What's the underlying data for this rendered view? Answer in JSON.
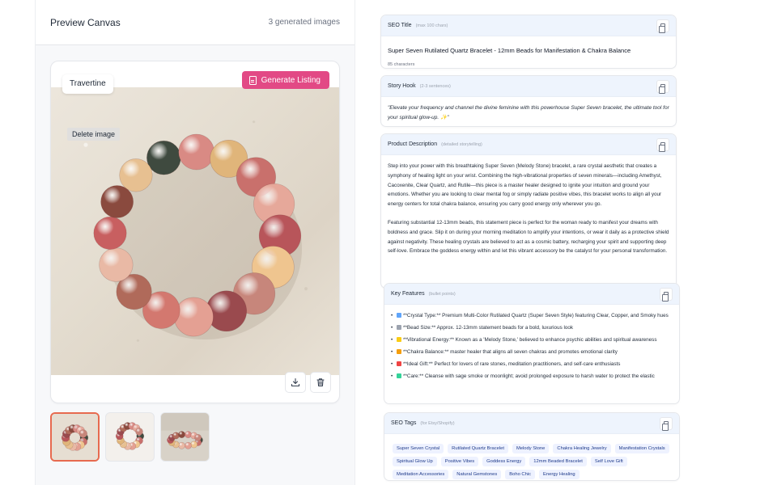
{
  "canvas": {
    "title": "Preview Canvas",
    "count": "3 generated images",
    "chip_label": "Travertine",
    "generate_label": "Generate Listing",
    "tooltip": "Delete image",
    "actions": [
      "download-icon",
      "trash-icon"
    ],
    "thumbnails": [
      {
        "name": "thumbnail-1",
        "selected": true
      },
      {
        "name": "thumbnail-2",
        "selected": false
      },
      {
        "name": "thumbnail-3",
        "selected": false
      }
    ],
    "accent": "#e24985"
  },
  "seo_title": {
    "label": "SEO Title",
    "hint": "(max 100 chars)",
    "value": "Super Seven Rutilated Quartz Bracelet - 12mm Beads for Manifestation & Chakra Balance",
    "count": "85 characters"
  },
  "story_hook": {
    "label": "Story Hook",
    "hint": "(2-3 sentences)",
    "value": "\"Elevate your frequency and channel the divine feminine with this powerhouse Super Seven bracelet, the ultimate tool for your spiritual glow-up. ✨\""
  },
  "description": {
    "label": "Product Description",
    "hint": "(detailed storytelling)",
    "p1": "Step into your power with this breathtaking Super Seven (Melody Stone) bracelet, a rare crystal aesthetic that creates a symphony of healing light on your wrist. Combining the high-vibrational properties of seven minerals—including Amethyst, Cacoxenite, Clear Quartz, and Rutile—this piece is a master healer designed to ignite your intuition and ground your emotions. Whether you are looking to clear mental fog or simply radiate positive vibes, this bracelet works to align all your energy centers for total chakra balance, ensuring you carry good energy only wherever you go.",
    "p2": "Featuring substantial 12-13mm beads, this statement piece is perfect for the woman ready to manifest your dreams with boldness and grace. Slip it on during your morning meditation to amplify your intentions, or wear it daily as a protective shield against negativity. These healing crystals are believed to act as a cosmic battery, recharging your spirit and supporting deep self-love. Embrace the goddess energy within and let this vibrant accessory be the catalyst for your personal transformation."
  },
  "features": {
    "label": "Key Features",
    "hint": "(bullet points)",
    "items": [
      {
        "icon": "gem-icon",
        "color": "#60a5fa",
        "text": "**Crystal Type:** Premium Multi-Color Rutilated Quartz (Super Seven Style) featuring Clear, Copper, and Smoky hues"
      },
      {
        "icon": "ruler-icon",
        "color": "#9ca3af",
        "text": "**Bead Size:** Approx. 12-13mm statement beads for a bold, luxurious look"
      },
      {
        "icon": "sparkle-icon",
        "color": "#facc15",
        "text": "**Vibrational Energy:** Known as a 'Melody Stone,' believed to enhance psychic abilities and spiritual awareness"
      },
      {
        "icon": "meditation-icon",
        "color": "#f59e0b",
        "text": "**Chakra Balance:** master healer that aligns all seven chakras and promotes emotional clarity"
      },
      {
        "icon": "gift-icon",
        "color": "#ef4444",
        "text": "**Ideal Gift:** Perfect for lovers of rare stones, meditation practitioners, and self-care enthusiasts"
      },
      {
        "icon": "leaf-icon",
        "color": "#34d399",
        "text": "**Care:** Cleanse with sage smoke or moonlight; avoid prolonged exposure to harsh water to protect the elastic"
      }
    ]
  },
  "tags": {
    "label": "SEO Tags",
    "hint": "(for Etsy/Shopify)",
    "items": [
      "Super Seven Crystal",
      "Rutilated Quartz Bracelet",
      "Melody Stone",
      "Chakra Healing Jewelry",
      "Manifestation Crystals",
      "Spiritual Glow Up",
      "Positive Vibes",
      "Goddess Energy",
      "12mm Beaded Bracelet",
      "Self Love Gift",
      "Meditation Accessories",
      "Natural Gemstones",
      "Boho Chic",
      "Energy Healing"
    ]
  }
}
